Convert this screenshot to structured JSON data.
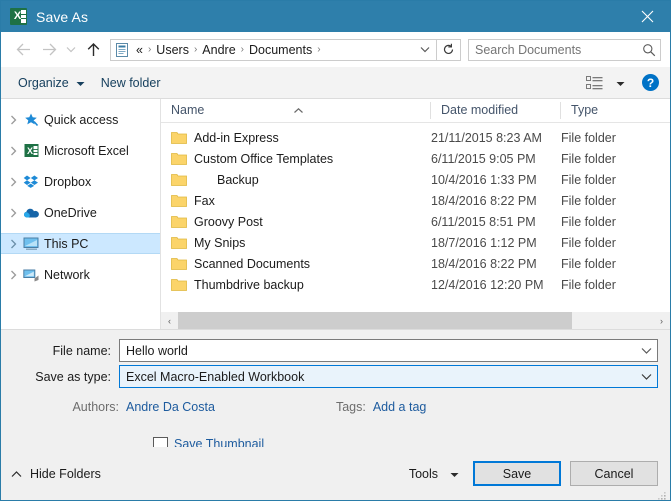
{
  "window": {
    "title": "Save As",
    "app_icon": "excel-icon",
    "close_label": "✕",
    "titlebar_color": "#2e7fab"
  },
  "nav": {
    "back_icon": "arrow-left-icon",
    "forward_icon": "arrow-right-icon",
    "recent_icon": "chevron-down-icon",
    "up_icon": "arrow-up-icon",
    "address_icon": "documents-folder-icon",
    "crumbs": [
      {
        "label": "«",
        "sep": ""
      },
      {
        "label": "Users",
        "sep": "›"
      },
      {
        "label": "Andre",
        "sep": "›"
      },
      {
        "label": "Documents",
        "sep": "›"
      }
    ],
    "dropdown_icon": "chevron-down-icon",
    "refresh_icon": "refresh-icon"
  },
  "search": {
    "placeholder": "Search Documents",
    "value": "",
    "icon": "search-icon"
  },
  "toolbar": {
    "organize_label": "Organize",
    "organize_caret": "▼",
    "new_folder_label": "New folder",
    "view_icon": "view-list-icon",
    "view_caret": "▼",
    "help_label": "?"
  },
  "sidebar": {
    "items": [
      {
        "label": "Quick access",
        "icon": "star-pin-icon",
        "selected": false
      },
      {
        "label": "Microsoft Excel",
        "icon": "excel-icon",
        "selected": false
      },
      {
        "label": "Dropbox",
        "icon": "dropbox-icon",
        "selected": false
      },
      {
        "label": "OneDrive",
        "icon": "onedrive-cloud-icon",
        "selected": false
      },
      {
        "label": "This PC",
        "icon": "this-pc-monitor-icon",
        "selected": true
      },
      {
        "label": "Network",
        "icon": "network-icon",
        "selected": false
      }
    ]
  },
  "filelist": {
    "columns": [
      "Name",
      "Date modified",
      "Type"
    ],
    "sort_indicator": "▲",
    "rows": [
      {
        "name": "Add-in Express",
        "date": "21/11/2015 8:23 AM",
        "type": "File folder",
        "indented": false
      },
      {
        "name": "Custom Office Templates",
        "date": "6/11/2015 9:05 PM",
        "type": "File folder",
        "indented": false
      },
      {
        "name": "Backup",
        "date": "10/4/2016 1:33 PM",
        "type": "File folder",
        "indented": true
      },
      {
        "name": "Fax",
        "date": "18/4/2016 8:22 PM",
        "type": "File folder",
        "indented": false
      },
      {
        "name": "Groovy Post",
        "date": "6/11/2015 8:51 PM",
        "type": "File folder",
        "indented": false
      },
      {
        "name": "My Snips",
        "date": "18/7/2016 1:12 PM",
        "type": "File folder",
        "indented": false
      },
      {
        "name": "Scanned Documents",
        "date": "18/4/2016 8:22 PM",
        "type": "File folder",
        "indented": false
      },
      {
        "name": "Thumbdrive backup",
        "date": "12/4/2016 12:20 PM",
        "type": "File folder",
        "indented": false
      }
    ],
    "scroll_left_icon": "‹",
    "scroll_right_icon": "›"
  },
  "form": {
    "file_name_label": "File name:",
    "file_name_value": "Hello world",
    "save_as_type_label": "Save as type:",
    "save_as_type_value": "Excel Macro-Enabled Workbook",
    "authors_label": "Authors:",
    "authors_value": "Andre Da Costa",
    "tags_label": "Tags:",
    "tags_value": "Add a tag",
    "thumbnail_label": "Save Thumbnail",
    "thumbnail_checked": false
  },
  "footer": {
    "hide_folders_label": "Hide Folders",
    "hide_folders_icon": "chevron-up-icon",
    "tools_label": "Tools",
    "tools_caret": "▼",
    "save_label": "Save",
    "cancel_label": "Cancel"
  },
  "colors": {
    "titlebar": "#2e7fab",
    "accent": "#0078d7",
    "selection": "#cce8ff",
    "link": "#1d5b9e",
    "folder": "#fbd46a"
  }
}
